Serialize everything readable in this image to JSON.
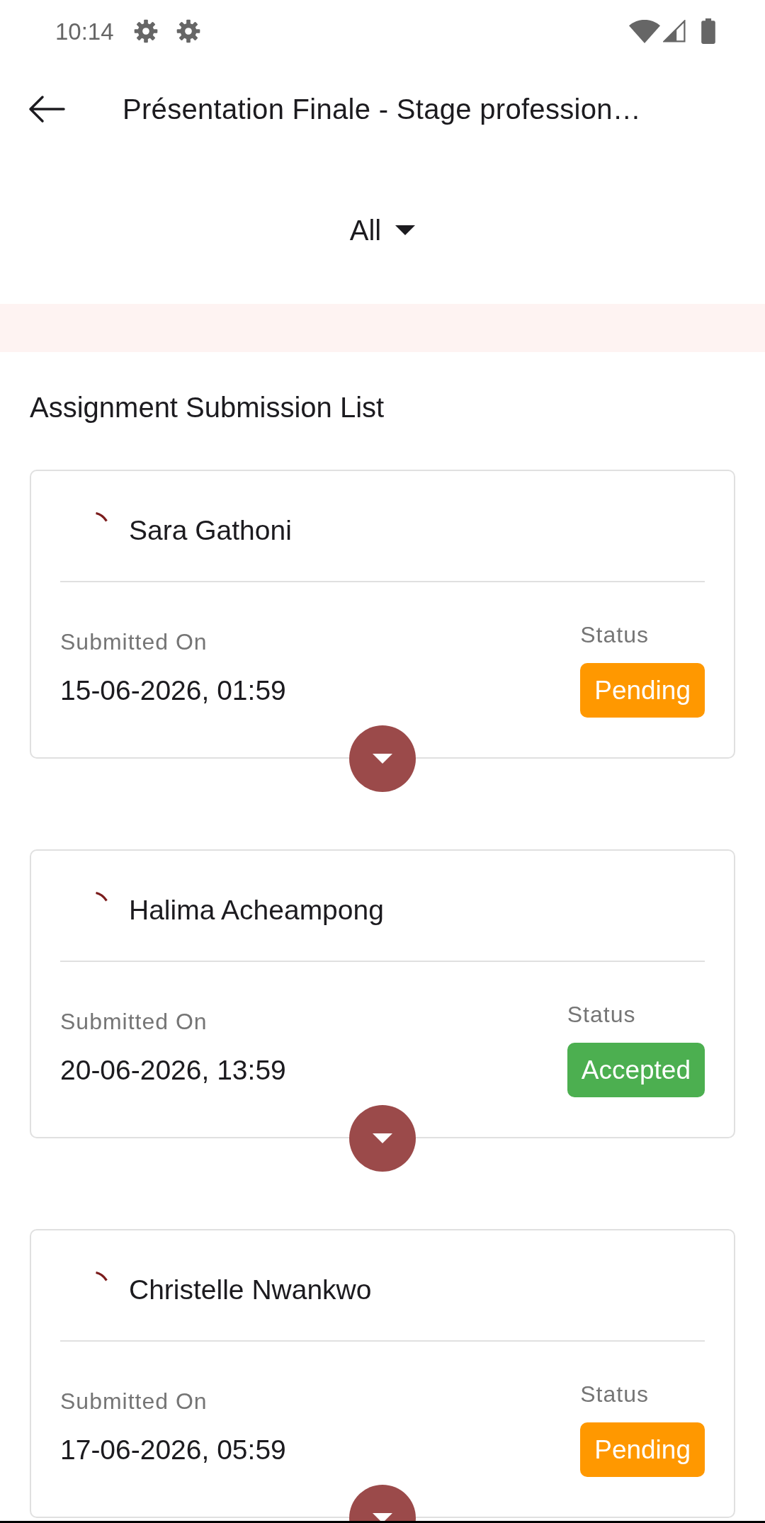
{
  "status_bar": {
    "time": "10:14"
  },
  "header": {
    "title": "Présentation Finale - Stage profession…"
  },
  "filter": {
    "label": "All"
  },
  "section_title": "Assignment Submission List",
  "submissions": [
    {
      "name": "Sara Gathoni",
      "submitted_label": "Submitted On",
      "submitted_on": "15-06-2026, 01:59",
      "status_label": "Status",
      "status": {
        "text": "Pending",
        "color": "#ff9800"
      }
    },
    {
      "name": "Halima Acheampong",
      "submitted_label": "Submitted On",
      "submitted_on": "20-06-2026, 13:59",
      "status_label": "Status",
      "status": {
        "text": "Accepted",
        "color": "#4caf50"
      }
    },
    {
      "name": "Christelle Nwankwo",
      "submitted_label": "Submitted On",
      "submitted_on": "17-06-2026, 05:59",
      "status_label": "Status",
      "status": {
        "text": "Pending",
        "color": "#ff9800"
      }
    }
  ]
}
